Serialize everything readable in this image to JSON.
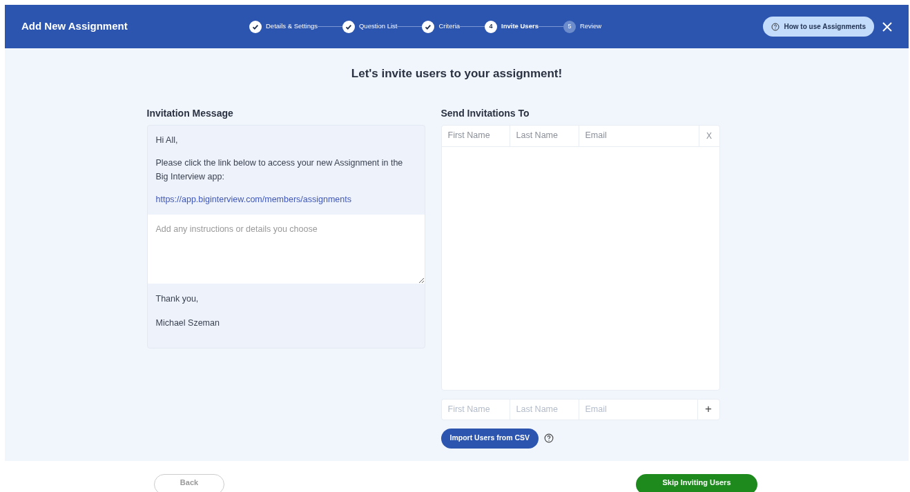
{
  "header": {
    "title": "Add New Assignment",
    "help_button": "How to use Assignments"
  },
  "steps": [
    {
      "label": "Details & Settings",
      "completed": true,
      "selected": false
    },
    {
      "label": "Question List",
      "completed": true,
      "selected": false
    },
    {
      "label": "Criteria",
      "completed": true,
      "selected": false
    },
    {
      "label": "Invite Users",
      "completed": false,
      "selected": true,
      "number": "4"
    },
    {
      "label": "Review",
      "completed": false,
      "selected": false,
      "number": "5"
    }
  ],
  "heading": "Let's invite users to your assignment!",
  "invitation": {
    "title": "Invitation Message",
    "greeting": "Hi All,",
    "body": "Please click the link below to access your new Assignment in the Big Interview app:",
    "link": "https://app.biginterview.com/members/assignments",
    "instructions_placeholder": "Add any instructions or details you choose",
    "closing": "Thank you,",
    "signature": "Michael Szeman"
  },
  "recipients": {
    "title": "Send Invitations To",
    "columns": [
      "First Name",
      "Last Name",
      "Email"
    ],
    "remove_label": "X",
    "new_row_placeholders": [
      "First Name",
      "Last Name",
      "Email"
    ],
    "add_label": "+",
    "import_button": "Import Users from CSV"
  },
  "footer": {
    "back_button": "Back",
    "skip_button": "Skip Inviting Users"
  }
}
